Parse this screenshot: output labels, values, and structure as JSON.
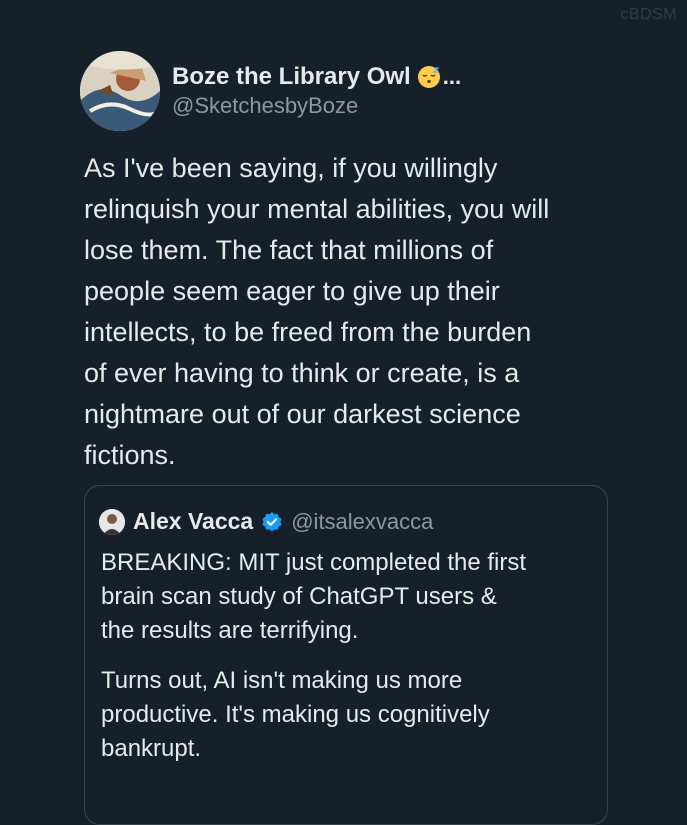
{
  "watermark": "cBDSM",
  "tweet": {
    "display_name": "Boze the Library Owl",
    "ellipsis": "...",
    "handle": "@SketchesbyBoze",
    "body": "As I've been saying, if you willingly\nrelinquish your mental abilities, you will\nlose them. The fact that millions of\npeople seem eager to give up their\nintellects, to be freed from the burden\nof ever having to think or create, is a\nnightmare out of our darkest science\nfictions."
  },
  "quote": {
    "display_name": "Alex Vacca",
    "handle": "@itsalexvacca",
    "paragraph_1": "BREAKING: MIT just completed the first\nbrain scan study of ChatGPT users &\nthe results are terrifying.",
    "paragraph_2": "Turns out, AI isn't making us more\nproductive. It's making us cognitively\nbankrupt."
  },
  "colors": {
    "background": "#15202b",
    "text": "#e7e9ea",
    "muted": "#8b98a5",
    "border": "#38444d",
    "verified": "#1d9bf0"
  },
  "icons": {
    "author_emoji": "sleeping-face-icon",
    "verified_badge": "verified-badge-icon"
  }
}
